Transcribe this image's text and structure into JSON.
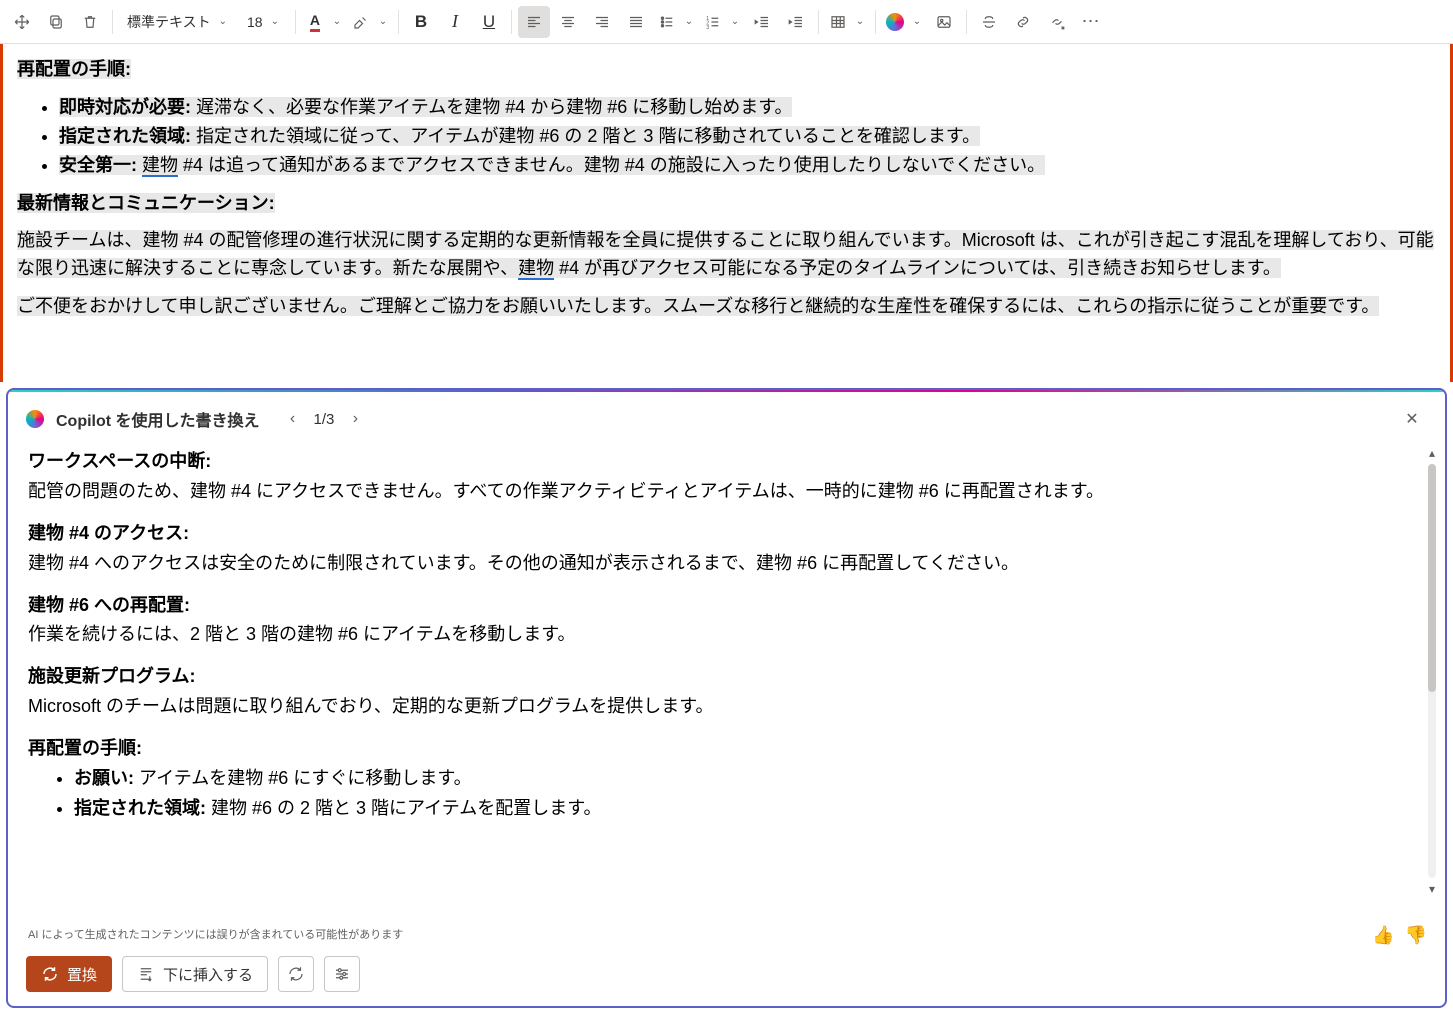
{
  "toolbar": {
    "style_combo": "標準テキスト",
    "font_size": "18",
    "bold": "B",
    "italic": "I",
    "underline": "U",
    "fontcolor_letter": "A"
  },
  "document": {
    "h1": "再配置の手順:",
    "li1_b": "即時対応が必要:",
    "li1_t": " 遅滞なく、必要な作業アイテムを建物 #4 から建物 #6 に移動し始めます。",
    "li2_b": "指定された領域:",
    "li2_t": " 指定された領域に従って、アイテムが建物 #6 の 2 階と 3 階に移動されていることを確認します。",
    "li3_b": "安全第一:",
    "li3_link": "建物",
    "li3_t1": " ",
    "li3_t2": " #4 は追って通知があるまでアクセスできません。建物 #4 の施設に入ったり使用したりしないでください。",
    "h2": "最新情報とコミュニケーション:",
    "p1a": "施設チームは、建物 #4 の配管修理の進行状況に関する定期的な更新情報を全員に提供することに取り組んでいます。Microsoft は、これが引き起こす混乱を理解しており、可能な限り迅速に解決することに専念しています。新たな展開や、",
    "p1_link": "建物",
    "p1b": " #4 が再びアクセス可能になる予定のタイムラインについては、引き続きお知らせします。",
    "p2": "ご不便をおかけして申し訳ございません。ご理解とご協力をお願いいたします。スムーズな移行と継続的な生産性を確保するには、これらの指示に従うことが重要です。"
  },
  "copilot": {
    "title": "Copilot を使用した書き換え",
    "counter": "1/3",
    "sections": {
      "s1_h": "ワークスペースの中断:",
      "s1_p": "配管の問題のため、建物 #4 にアクセスできません。すべての作業アクティビティとアイテムは、一時的に建物 #6 に再配置されます。",
      "s2_h": "建物 #4 のアクセス:",
      "s2_p": "建物 #4 へのアクセスは安全のために制限されています。その他の通知が表示されるまで、建物 #6 に再配置してください。",
      "s3_h": "建物 #6 への再配置:",
      "s3_p": "作業を続けるには、2 階と 3 階の建物 #6 にアイテムを移動します。",
      "s4_h": "施設更新プログラム:",
      "s4_p": "Microsoft のチームは問題に取り組んでおり、定期的な更新プログラムを提供します。",
      "s5_h": "再配置の手順:",
      "s5_li1_b": "お願い:",
      "s5_li1_t": " アイテムを建物 #6 にすぐに移動します。",
      "s5_li2_b": "指定された領域:",
      "s5_li2_t": " 建物 #6 の 2 階と 3 階にアイテムを配置します。"
    },
    "disclaimer": "AI によって生成されたコンテンツには誤りが含まれている可能性があります",
    "btn_replace": "置換",
    "btn_insert": "下に挿入する"
  }
}
